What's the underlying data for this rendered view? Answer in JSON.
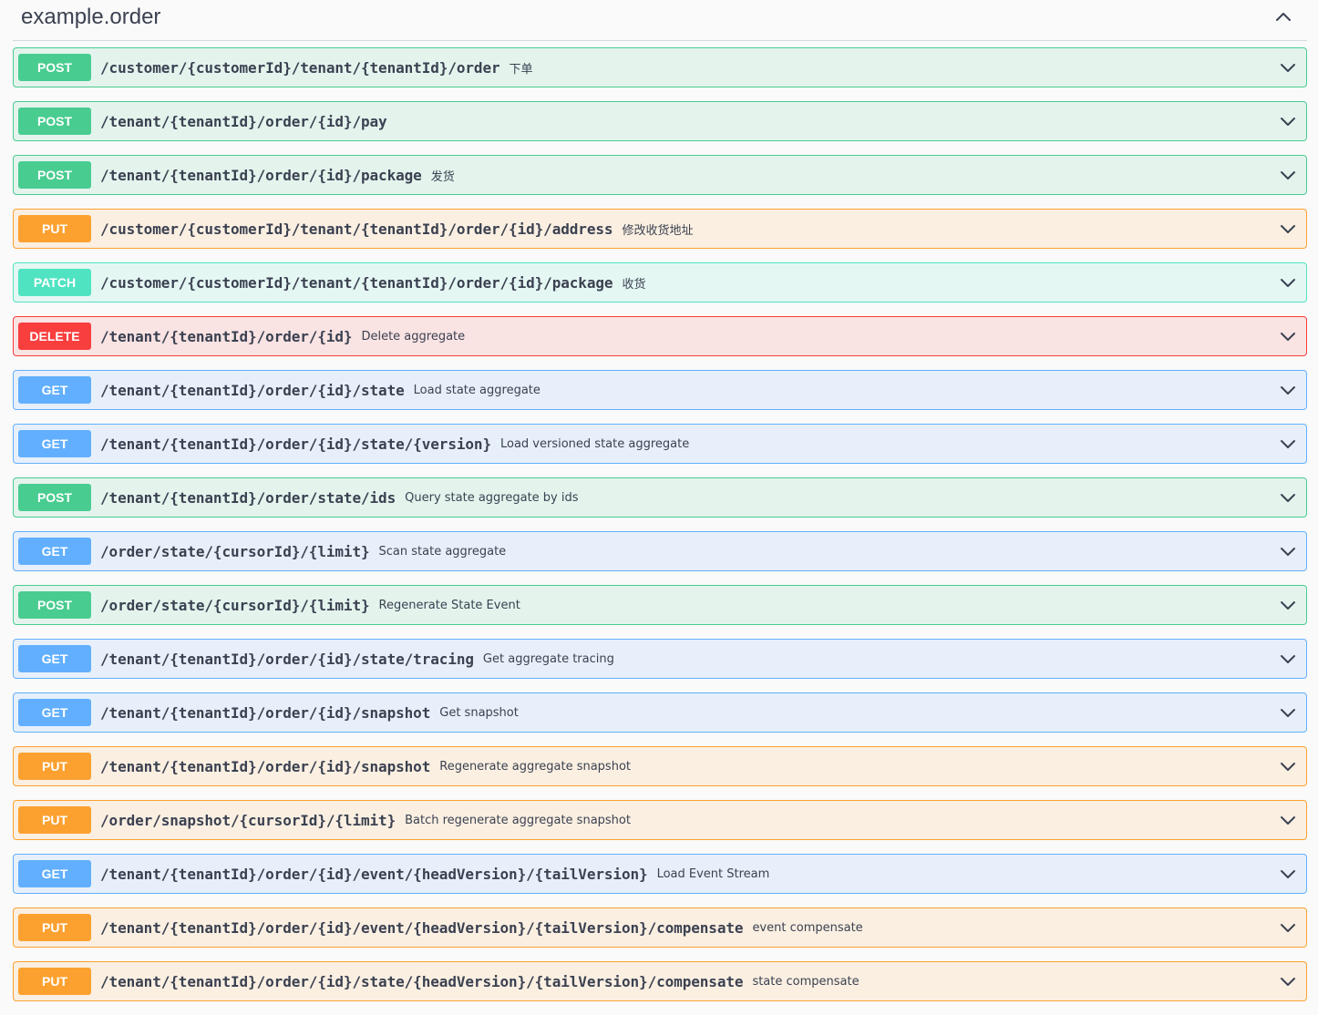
{
  "section": {
    "title": "example.order",
    "collapse_icon": "chevron-up-icon"
  },
  "colors": {
    "POST": "#49cc90",
    "PUT": "#fca130",
    "PATCH": "#50e3c2",
    "DELETE": "#f93e3e",
    "GET": "#61affe"
  },
  "operations": [
    {
      "method": "POST",
      "path": "/customer/{customerId}/tenant/{tenantId}/order",
      "summary": "下单"
    },
    {
      "method": "POST",
      "path": "/tenant/{tenantId}/order/{id}/pay",
      "summary": ""
    },
    {
      "method": "POST",
      "path": "/tenant/{tenantId}/order/{id}/package",
      "summary": "发货"
    },
    {
      "method": "PUT",
      "path": "/customer/{customerId}/tenant/{tenantId}/order/{id}/address",
      "summary": "修改收货地址"
    },
    {
      "method": "PATCH",
      "path": "/customer/{customerId}/tenant/{tenantId}/order/{id}/package",
      "summary": "收货"
    },
    {
      "method": "DELETE",
      "path": "/tenant/{tenantId}/order/{id}",
      "summary": "Delete aggregate"
    },
    {
      "method": "GET",
      "path": "/tenant/{tenantId}/order/{id}/state",
      "summary": "Load state aggregate"
    },
    {
      "method": "GET",
      "path": "/tenant/{tenantId}/order/{id}/state/{version}",
      "summary": "Load versioned state aggregate"
    },
    {
      "method": "POST",
      "path": "/tenant/{tenantId}/order/state/ids",
      "summary": "Query state aggregate by ids"
    },
    {
      "method": "GET",
      "path": "/order/state/{cursorId}/{limit}",
      "summary": "Scan state aggregate"
    },
    {
      "method": "POST",
      "path": "/order/state/{cursorId}/{limit}",
      "summary": "Regenerate State Event"
    },
    {
      "method": "GET",
      "path": "/tenant/{tenantId}/order/{id}/state/tracing",
      "summary": "Get aggregate tracing"
    },
    {
      "method": "GET",
      "path": "/tenant/{tenantId}/order/{id}/snapshot",
      "summary": "Get snapshot"
    },
    {
      "method": "PUT",
      "path": "/tenant/{tenantId}/order/{id}/snapshot",
      "summary": "Regenerate aggregate snapshot"
    },
    {
      "method": "PUT",
      "path": "/order/snapshot/{cursorId}/{limit}",
      "summary": "Batch regenerate aggregate snapshot"
    },
    {
      "method": "GET",
      "path": "/tenant/{tenantId}/order/{id}/event/{headVersion}/{tailVersion}",
      "summary": "Load Event Stream"
    },
    {
      "method": "PUT",
      "path": "/tenant/{tenantId}/order/{id}/event/{headVersion}/{tailVersion}/compensate",
      "summary": "event compensate"
    },
    {
      "method": "PUT",
      "path": "/tenant/{tenantId}/order/{id}/state/{headVersion}/{tailVersion}/compensate",
      "summary": "state compensate"
    }
  ]
}
